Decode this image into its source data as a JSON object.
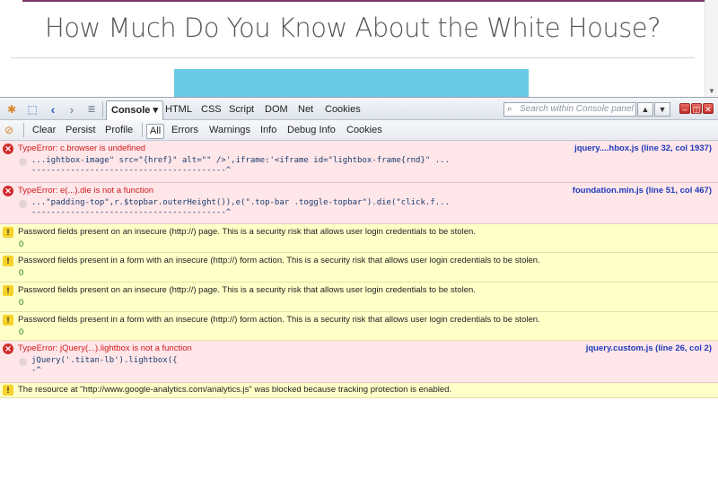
{
  "page": {
    "title": "How Much Do You Know About the White House?"
  },
  "toolbar": {
    "tabs": [
      "Console ▾",
      "HTML",
      "CSS",
      "Script",
      "DOM",
      "Net",
      "Cookies"
    ],
    "search_placeholder": "Search within Console panel",
    "nav_prev": "▲",
    "nav_next": "▼",
    "win_minimize": "–",
    "win_restore": "◫",
    "win_close": "✕"
  },
  "console_toolbar": {
    "items": [
      "Clear",
      "Persist",
      "Profile",
      "All",
      "Errors",
      "Warnings",
      "Info",
      "Debug Info",
      "Cookies"
    ]
  },
  "console": {
    "rows": [
      {
        "kind": "error",
        "message": "TypeError: c.browser is undefined",
        "source": "jquery....hbox.js (line 32, col 1937)",
        "code": "...ightbox-image\" src=\"{href}\" alt=\"\" />',iframe:'<iframe id=\"lightbox-frame{rnd}\" ...",
        "caret": "----------------------------------------^"
      },
      {
        "kind": "error",
        "message": "TypeError: e(...).die is not a function",
        "source": "foundation.min.js (line 51, col 467)",
        "code": "...\"padding-top\",r.$topbar.outerHeight()),e(\".top-bar .toggle-topbar\").die(\"click.f...",
        "caret": "----------------------------------------^"
      },
      {
        "kind": "warn",
        "message": "Password fields present on an insecure (http://) page. This is a security risk that allows user login credentials to be stolen.",
        "value": "0"
      },
      {
        "kind": "warn",
        "message": "Password fields present in a form with an insecure (http://) form action. This is a security risk that allows user login credentials to be stolen.",
        "value": "0"
      },
      {
        "kind": "warn",
        "message": "Password fields present on an insecure (http://) page. This is a security risk that allows user login credentials to be stolen.",
        "value": "0"
      },
      {
        "kind": "warn",
        "message": "Password fields present in a form with an insecure (http://) form action. This is a security risk that allows user login credentials to be stolen.",
        "value": "0"
      },
      {
        "kind": "error",
        "message": "TypeError: jQuery(...).lightbox is not a function",
        "source": "jquery.custom.js (line 26, col 2)",
        "code": "jQuery('.titan-lb').lightbox({",
        "caret": "-^"
      },
      {
        "kind": "warn",
        "message": "The resource at \"http://www.google-analytics.com/analytics.js\" was blocked because tracking protection is enabled."
      }
    ]
  },
  "colors": {
    "error_bg": "#ffe6e9",
    "warn_bg": "#ffffc8",
    "error_text": "#d11a1a",
    "source_link": "#1f3bbd",
    "banner": "#6ac9e4"
  },
  "icons": [
    "firebug-icon",
    "inspect-icon",
    "back-arrow-icon",
    "forward-arrow-icon",
    "command-line-icon",
    "search-icon",
    "clear-console-icon",
    "error-icon",
    "warning-icon"
  ]
}
